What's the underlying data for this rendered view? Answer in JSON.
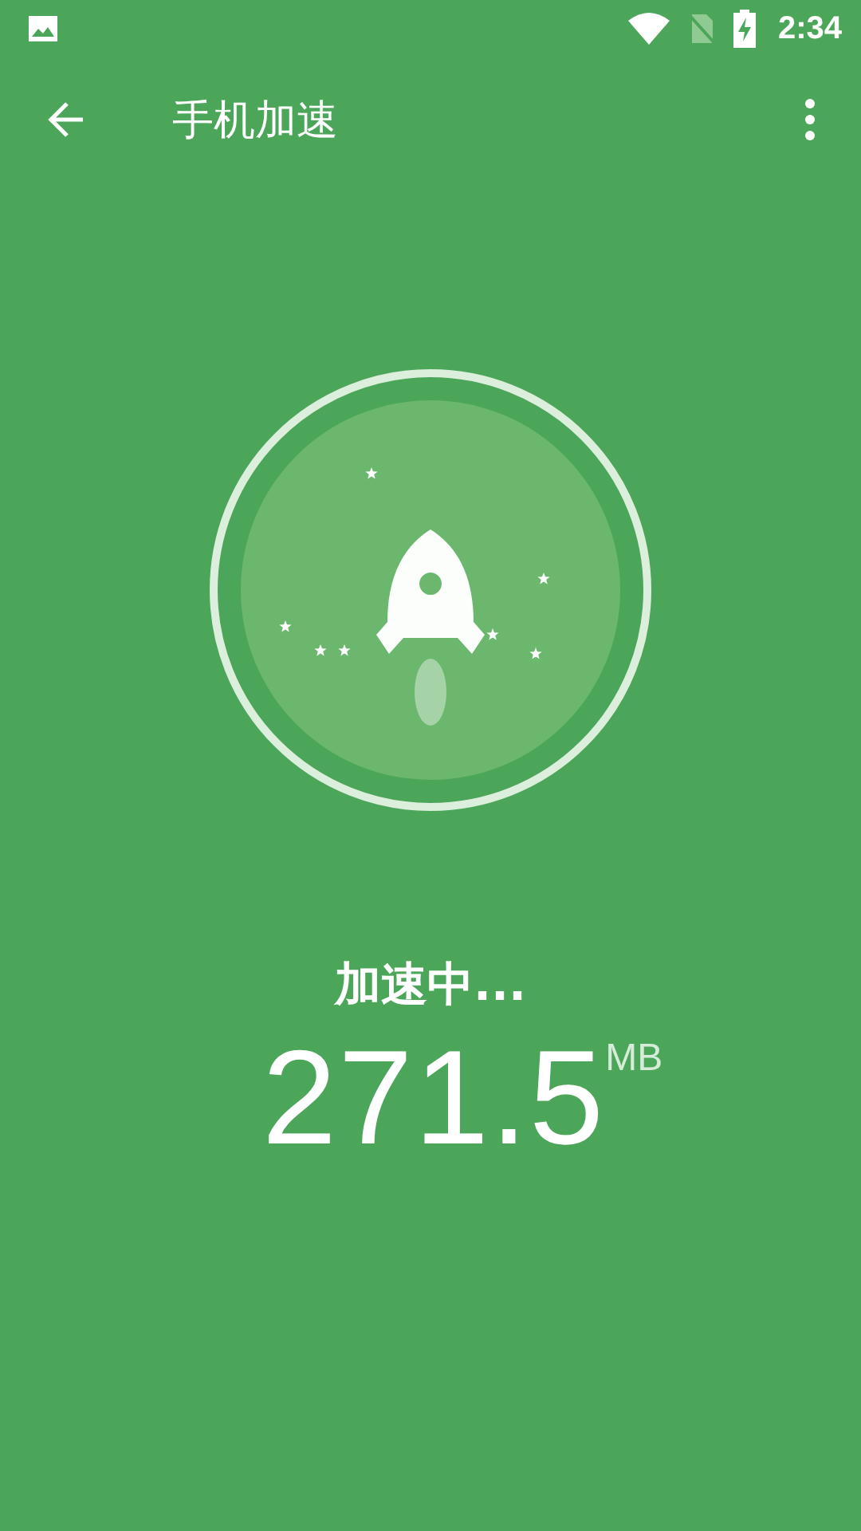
{
  "status_bar": {
    "time": "2:34"
  },
  "toolbar": {
    "title": "手机加速"
  },
  "status": {
    "label": "加速中...",
    "amount": "271.5",
    "unit": "MB"
  }
}
